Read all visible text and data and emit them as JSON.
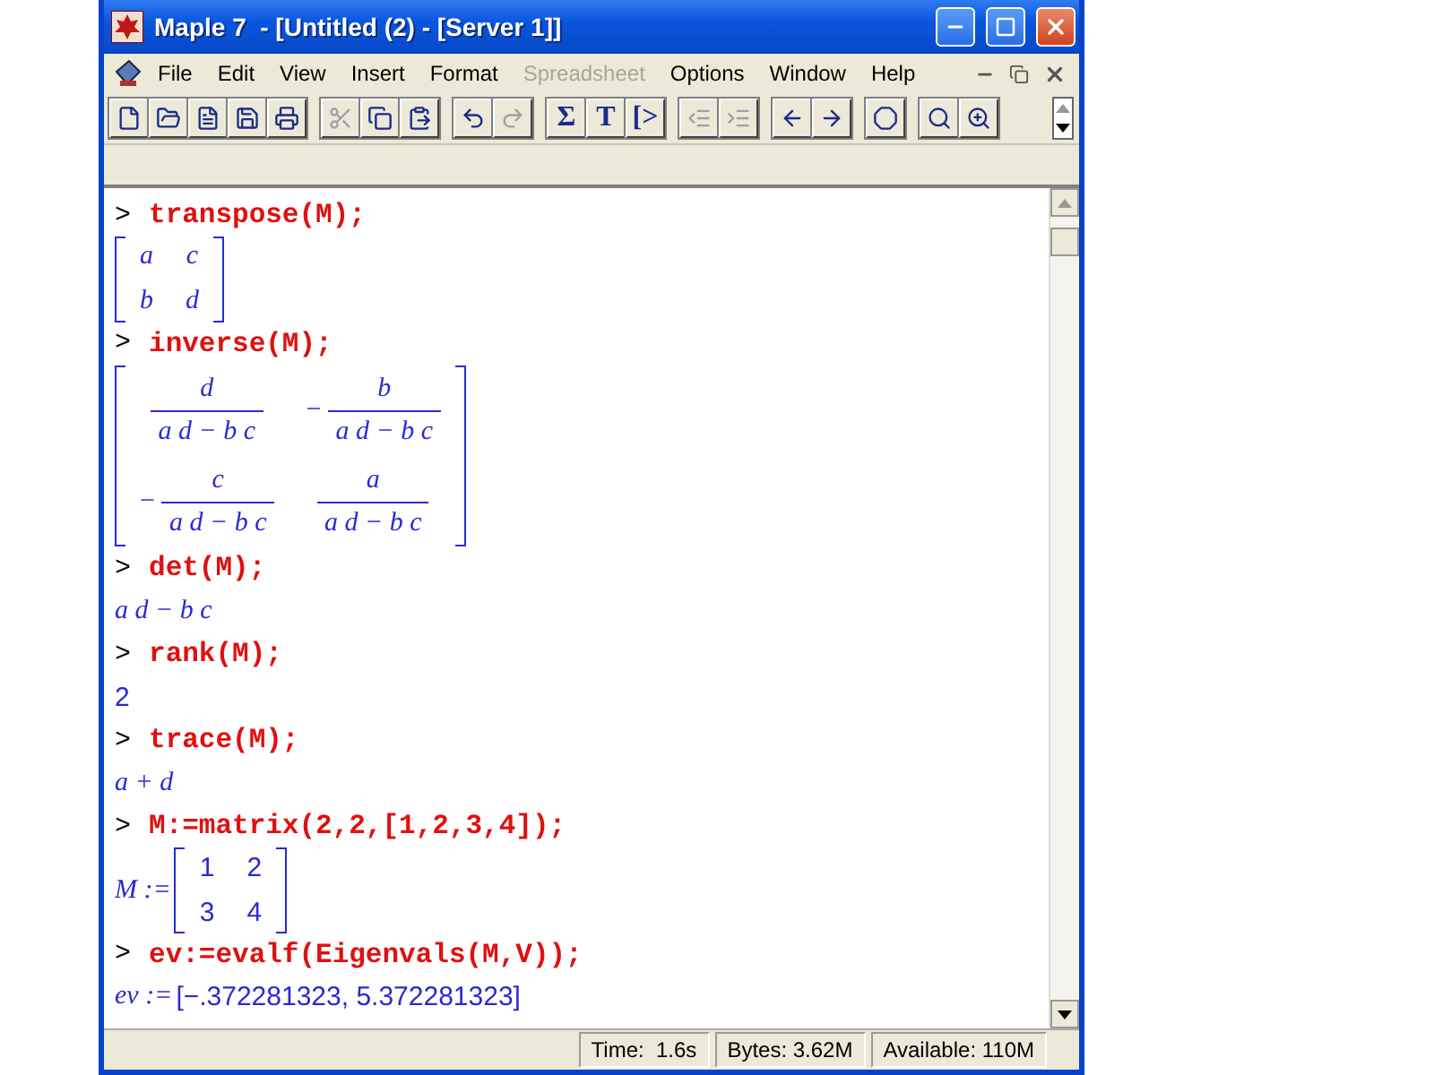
{
  "window": {
    "title": "Maple 7  - [Untitled (2) - [Server 1]]"
  },
  "menu": [
    {
      "label": "File",
      "disabled": false
    },
    {
      "label": "Edit",
      "disabled": false
    },
    {
      "label": "View",
      "disabled": false
    },
    {
      "label": "Insert",
      "disabled": false
    },
    {
      "label": "Format",
      "disabled": false
    },
    {
      "label": "Spreadsheet",
      "disabled": true
    },
    {
      "label": "Options",
      "disabled": false
    },
    {
      "label": "Window",
      "disabled": false
    },
    {
      "label": "Help",
      "disabled": false
    }
  ],
  "toolbar": [
    [
      {
        "kind": "new",
        "disabled": false
      },
      {
        "kind": "open",
        "disabled": false
      },
      {
        "kind": "info",
        "disabled": false
      },
      {
        "kind": "save",
        "disabled": false
      },
      {
        "kind": "print",
        "disabled": false
      }
    ],
    [
      {
        "kind": "cut",
        "disabled": true
      },
      {
        "kind": "copy",
        "disabled": false
      },
      {
        "kind": "paste",
        "disabled": false
      }
    ],
    [
      {
        "kind": "undo",
        "disabled": false
      },
      {
        "kind": "redo",
        "disabled": true
      }
    ],
    [
      {
        "kind": "text",
        "label": "Σ",
        "disabled": false
      },
      {
        "kind": "text",
        "label": "T",
        "disabled": false
      },
      {
        "kind": "text",
        "label": "[>",
        "disabled": false
      }
    ],
    [
      {
        "kind": "outdent",
        "disabled": true
      },
      {
        "kind": "indent",
        "disabled": true
      }
    ],
    [
      {
        "kind": "back",
        "disabled": false
      },
      {
        "kind": "forward",
        "disabled": false
      }
    ],
    [
      {
        "kind": "stop",
        "disabled": false
      }
    ],
    [
      {
        "kind": "zoomsmall",
        "disabled": false
      },
      {
        "kind": "zoomlarge",
        "disabled": false
      }
    ]
  ],
  "worksheet": [
    {
      "kind": "input",
      "prompt": ">",
      "text": "transpose(M);"
    },
    {
      "kind": "matrix",
      "italic": true,
      "rows": [
        [
          {
            "text": "a"
          },
          {
            "text": "c"
          }
        ],
        [
          {
            "text": "b"
          },
          {
            "text": "d"
          }
        ]
      ]
    },
    {
      "kind": "input",
      "prompt": ">",
      "text": "inverse(M);"
    },
    {
      "kind": "matrix",
      "italic": true,
      "rows": [
        [
          {
            "num": "d",
            "den": "a d − b c"
          },
          {
            "sign": "−",
            "num": "b",
            "den": "a d − b c"
          }
        ],
        [
          {
            "sign": "−",
            "num": "c",
            "den": "a d − b c"
          },
          {
            "num": "a",
            "den": "a d − b c"
          }
        ]
      ]
    },
    {
      "kind": "input",
      "prompt": ">",
      "text": "det(M);"
    },
    {
      "kind": "expr",
      "italic": true,
      "text": "a d − b c"
    },
    {
      "kind": "input",
      "prompt": ">",
      "text": "rank(M);"
    },
    {
      "kind": "expr",
      "italic": false,
      "text": "2"
    },
    {
      "kind": "input",
      "prompt": ">",
      "text": "trace(M);"
    },
    {
      "kind": "expr",
      "italic": true,
      "text": "a + d"
    },
    {
      "kind": "input",
      "prompt": ">",
      "text": "M:=matrix(2,2,[1,2,3,4]);"
    },
    {
      "kind": "matrix",
      "italic": false,
      "label": "M :=",
      "rows": [
        [
          {
            "text": "1"
          },
          {
            "text": "2"
          }
        ],
        [
          {
            "text": "3"
          },
          {
            "text": "4"
          }
        ]
      ]
    },
    {
      "kind": "input",
      "prompt": ">",
      "text": "ev:=evalf(Eigenvals(M,V));"
    },
    {
      "kind": "expr",
      "italic": false,
      "label": "ev :=",
      "text": "[−.372281323, 5.372281323]"
    }
  ],
  "status_bar": [
    "Time:  1.6s",
    "Bytes: 3.62M",
    "Available: 110M"
  ]
}
